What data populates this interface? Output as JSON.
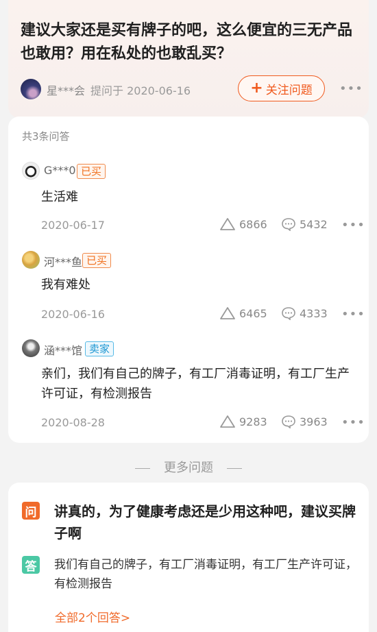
{
  "question": {
    "title": "建议大家还是买有牌子的吧，这么便宜的三无产品也敢用？用在私处的也敢乱买？",
    "author": "星***会",
    "asked": "提问于 2020-06-16",
    "follow_plus": "+",
    "follow_label": "关注问题",
    "more": "•••"
  },
  "answers_card": {
    "count_label": "共3条问答",
    "answers": [
      {
        "name": "G***0",
        "badge": "已买",
        "text": "生活难",
        "date": "2020-06-17",
        "likes": "6866",
        "comments": "5432",
        "more": "•••"
      },
      {
        "name": "河***鱼",
        "badge": "已买",
        "text": "我有难处",
        "date": "2020-06-16",
        "likes": "6465",
        "comments": "4333",
        "more": "•••"
      },
      {
        "name": "涵***馆",
        "badge": "卖家",
        "text": "亲们，我们有自己的牌子，有工厂消毒证明，有工厂生产许可证，有检测报告",
        "date": "2020-08-28",
        "likes": "9283",
        "comments": "3963",
        "more": "•••"
      }
    ]
  },
  "more_questions": {
    "label": "更多问题"
  },
  "related": {
    "q_tag": "问",
    "question": "讲真的，为了健康考虑还是少用这种吧，建议买牌子啊",
    "a_tag": "答",
    "answer": "我们有自己的牌子，有工厂消毒证明，有工厂生产许可证，有检测报告",
    "all_answers": "全部2个回答>"
  },
  "colors": {
    "accent": "#f05a1e",
    "seller": "#1a96d2",
    "answer_tag": "#4bc8a4"
  }
}
